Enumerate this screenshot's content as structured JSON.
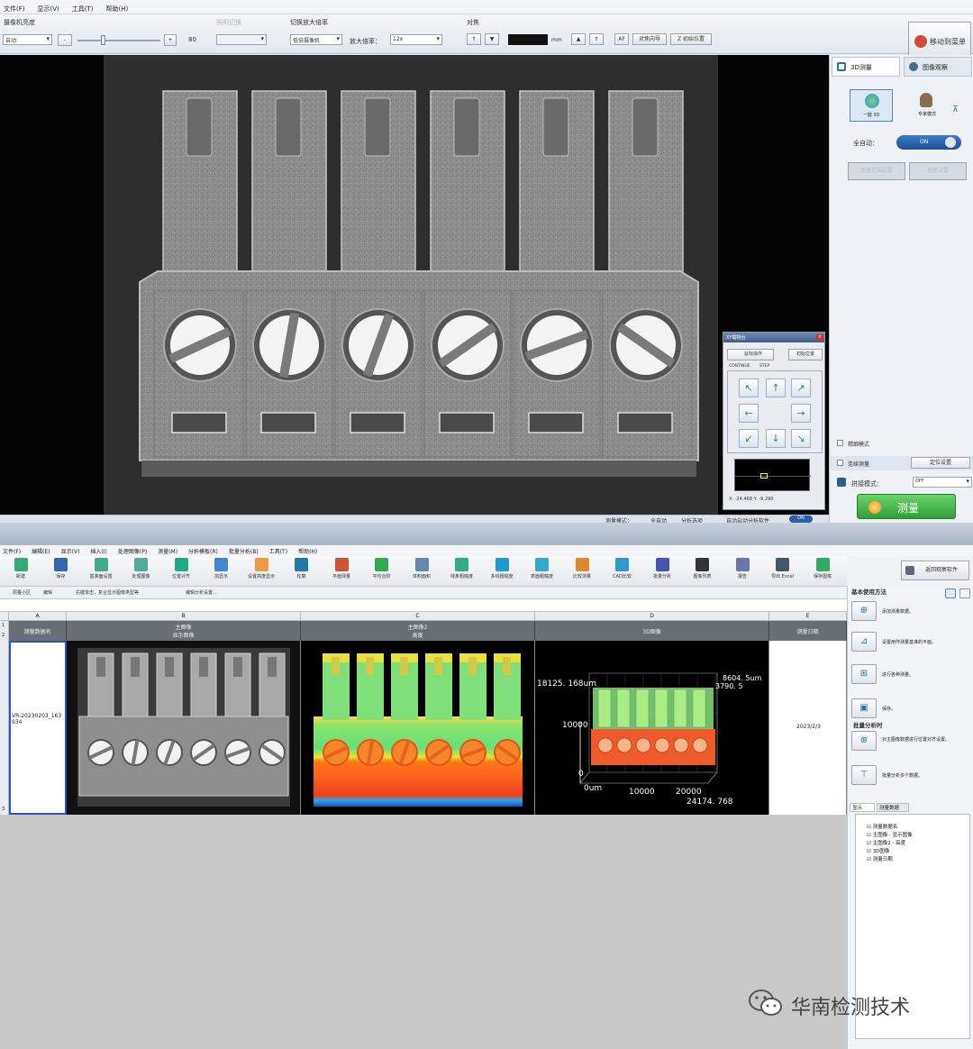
{
  "top": {
    "menu": [
      "文件(F)",
      "显示(V)",
      "工具(T)",
      "帮助(H)"
    ],
    "camera_brightness_label": "摄像机亮度",
    "brightness_mode": "自动",
    "brightness_value": "80",
    "faded_label": "照明切换",
    "zoom_switch_label": "切换放大倍率",
    "camera_select": "低倍摄像机",
    "zoom_label": "放大倍率：",
    "zoom_value": "12x",
    "focus_label": "对焦",
    "focus_unit": "mm",
    "btn_af": "AF",
    "btn_focus_guide": "对焦向导",
    "btn_z_init": "Z 初始位置",
    "btn_move_menu": "移动到菜单",
    "tab_3d": "3D测量",
    "tab_image": "图像观察",
    "btn_one_click_3d": "一键 3D",
    "btn_expert": "专家模式",
    "full_auto_label": "全自动：",
    "toggle_on": "ON",
    "btn_range_faded1": "测量范围设置",
    "btn_range_faded2": "测量设置",
    "fine_mode": "精细模式",
    "continuous": "连续测量",
    "btn_position": "定位设置",
    "stitch_label": "拼接模式：",
    "stitch_value": "OFF",
    "measure_btn": "测量",
    "status_items": [
      "测量模式：",
      "全自动",
      "分析选项",
      "自动启动分析软件",
      "ON"
    ]
  },
  "joystick": {
    "title": "XY载物台",
    "mouse_op": "鼠标操作",
    "init_pos": "初始位置",
    "tab_cont": "CONTINUE",
    "tab_step": "STEP",
    "coords": "X: -24.468   Y: -9.290"
  },
  "bottom": {
    "menu": [
      "文件(F)",
      "编辑(E)",
      "显示(V)",
      "插入(I)",
      "处理图像(P)",
      "测量(M)",
      "分析模板(R)",
      "批量分析(B)",
      "工具(T)",
      "帮助(H)"
    ],
    "toolbar": [
      "新建",
      "保存",
      "基准面设置",
      "处理图像",
      "位置对齐",
      "加显示",
      "设置高度显示",
      "轮廓",
      "平面测量",
      "平均台阶",
      "体积面积",
      "线条粗糙度",
      "多线粗糙度",
      "表面粗糙度",
      "比较测量",
      "CAD比较",
      "批量分析",
      "图像列表",
      "报告",
      "导出 Excel",
      "保存图像"
    ],
    "btn_return": "返回观察软件",
    "ribbon": [
      "层叠小区",
      "编辑",
      "右键单击，复合显示图像类型等",
      "编辑分析设置..."
    ],
    "columns": [
      "A",
      "B",
      "C",
      "D",
      "E"
    ],
    "headers": {
      "name": "测量数据名",
      "main_image": "主图像",
      "main_image_sub": "显示图像",
      "main_image2": "主图像2",
      "main_image2_sub": "高度",
      "img3d": "3D图像",
      "date": "测量日期"
    },
    "row1": {
      "name": "VR-20230203_163934",
      "date": "2023/2/3"
    },
    "row_numbers": [
      "1",
      "2",
      "3"
    ],
    "plot3d": {
      "z_top_label": "18125. 168um",
      "top_right": "8604. 5um",
      "top_right2": "3790. 5",
      "y_10000": "10000",
      "y_0": "0",
      "x_0": "0um",
      "x_10000": "10000",
      "x_20000": "20000",
      "x_end": "24174. 768"
    },
    "help_title": "基本使用方法",
    "help_steps": [
      "添加测量数据。",
      "设置用作测量基准的平面。",
      "进行各种测量。",
      "保存。"
    ],
    "batch_title": "批量分析时",
    "batch_steps": [
      "对主图像数据进行位置对齐设置。",
      "批量分析多个数据。"
    ],
    "tabs": [
      "显示",
      "测量数据"
    ],
    "tree": [
      "测量数据名",
      "主图像 - 显示图像",
      "主图像2 - 高度",
      "3D图像",
      "测量日期"
    ]
  },
  "watermark": "华南检测技术"
}
